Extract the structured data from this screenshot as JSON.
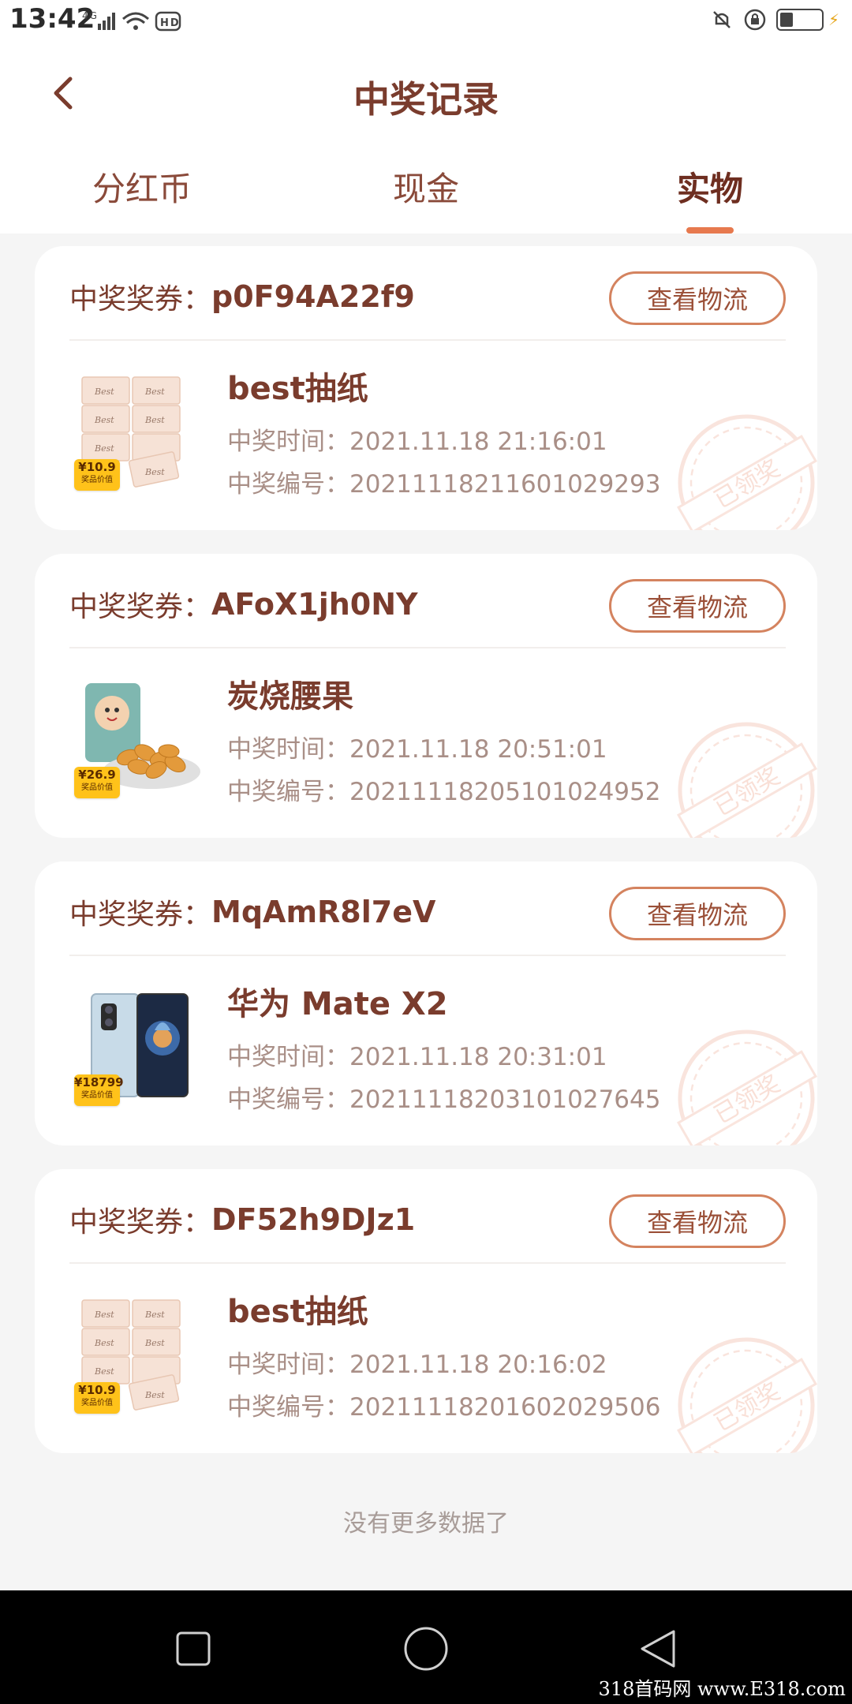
{
  "status": {
    "time": "13:42",
    "left_icons": "4G  HD"
  },
  "header": {
    "title": "中奖记录"
  },
  "tabs": [
    {
      "label": "分红币",
      "active": false
    },
    {
      "label": "现金",
      "active": false
    },
    {
      "label": "实物",
      "active": true
    }
  ],
  "cards": [
    {
      "voucher_label": "中奖奖券：",
      "voucher_code": "p0F94A22f9",
      "button": "查看物流",
      "product_name": "best抽纸",
      "time_line": "中奖时间：2021.11.18 21:16:01",
      "number_line": "中奖编号：20211118211601029293",
      "price": "¥10.9",
      "price_caption": "奖品价值",
      "stamp": "已领奖",
      "image": "tissue-icon"
    },
    {
      "voucher_label": "中奖奖券：",
      "voucher_code": "AFoX1jh0NY",
      "button": "查看物流",
      "product_name": "炭烧腰果",
      "time_line": "中奖时间：2021.11.18 20:51:01",
      "number_line": "中奖编号：20211118205101024952",
      "price": "¥26.9",
      "price_caption": "奖品价值",
      "stamp": "已领奖",
      "image": "cashew-icon"
    },
    {
      "voucher_label": "中奖奖券：",
      "voucher_code": "MqAmR8l7eV",
      "button": "查看物流",
      "product_name": "华为 Mate X2",
      "time_line": "中奖时间：2021.11.18 20:31:01",
      "number_line": "中奖编号：20211118203101027645",
      "price": "¥18799",
      "price_caption": "奖品价值",
      "stamp": "已领奖",
      "image": "phone-icon"
    },
    {
      "voucher_label": "中奖奖券：",
      "voucher_code": "DF52h9DJz1",
      "button": "查看物流",
      "product_name": "best抽纸",
      "time_line": "中奖时间：2021.11.18 20:16:02",
      "number_line": "中奖编号：20211118201602029506",
      "price": "¥10.9",
      "price_caption": "奖品价值",
      "stamp": "已领奖",
      "image": "tissue-icon"
    }
  ],
  "footer_text": "没有更多数据了",
  "watermark": "318首码网 www.E318.com",
  "colors": {
    "accent": "#e7794e",
    "title": "#7a3c2d",
    "muted": "#a98f87"
  }
}
